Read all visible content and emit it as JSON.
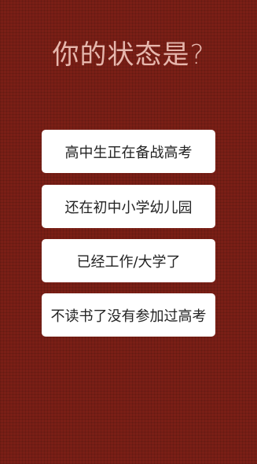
{
  "question": {
    "title": "你的状态是?"
  },
  "options": [
    {
      "label": "高中生正在备战高考"
    },
    {
      "label": "还在初中小学幼儿园"
    },
    {
      "label": "已经工作/大学了"
    },
    {
      "label": "不读书了没有参加过高考"
    }
  ],
  "colors": {
    "background": "#7a1f16",
    "title_text": "#e6b7ad",
    "button_bg": "#ffffff",
    "button_text": "#222222"
  }
}
